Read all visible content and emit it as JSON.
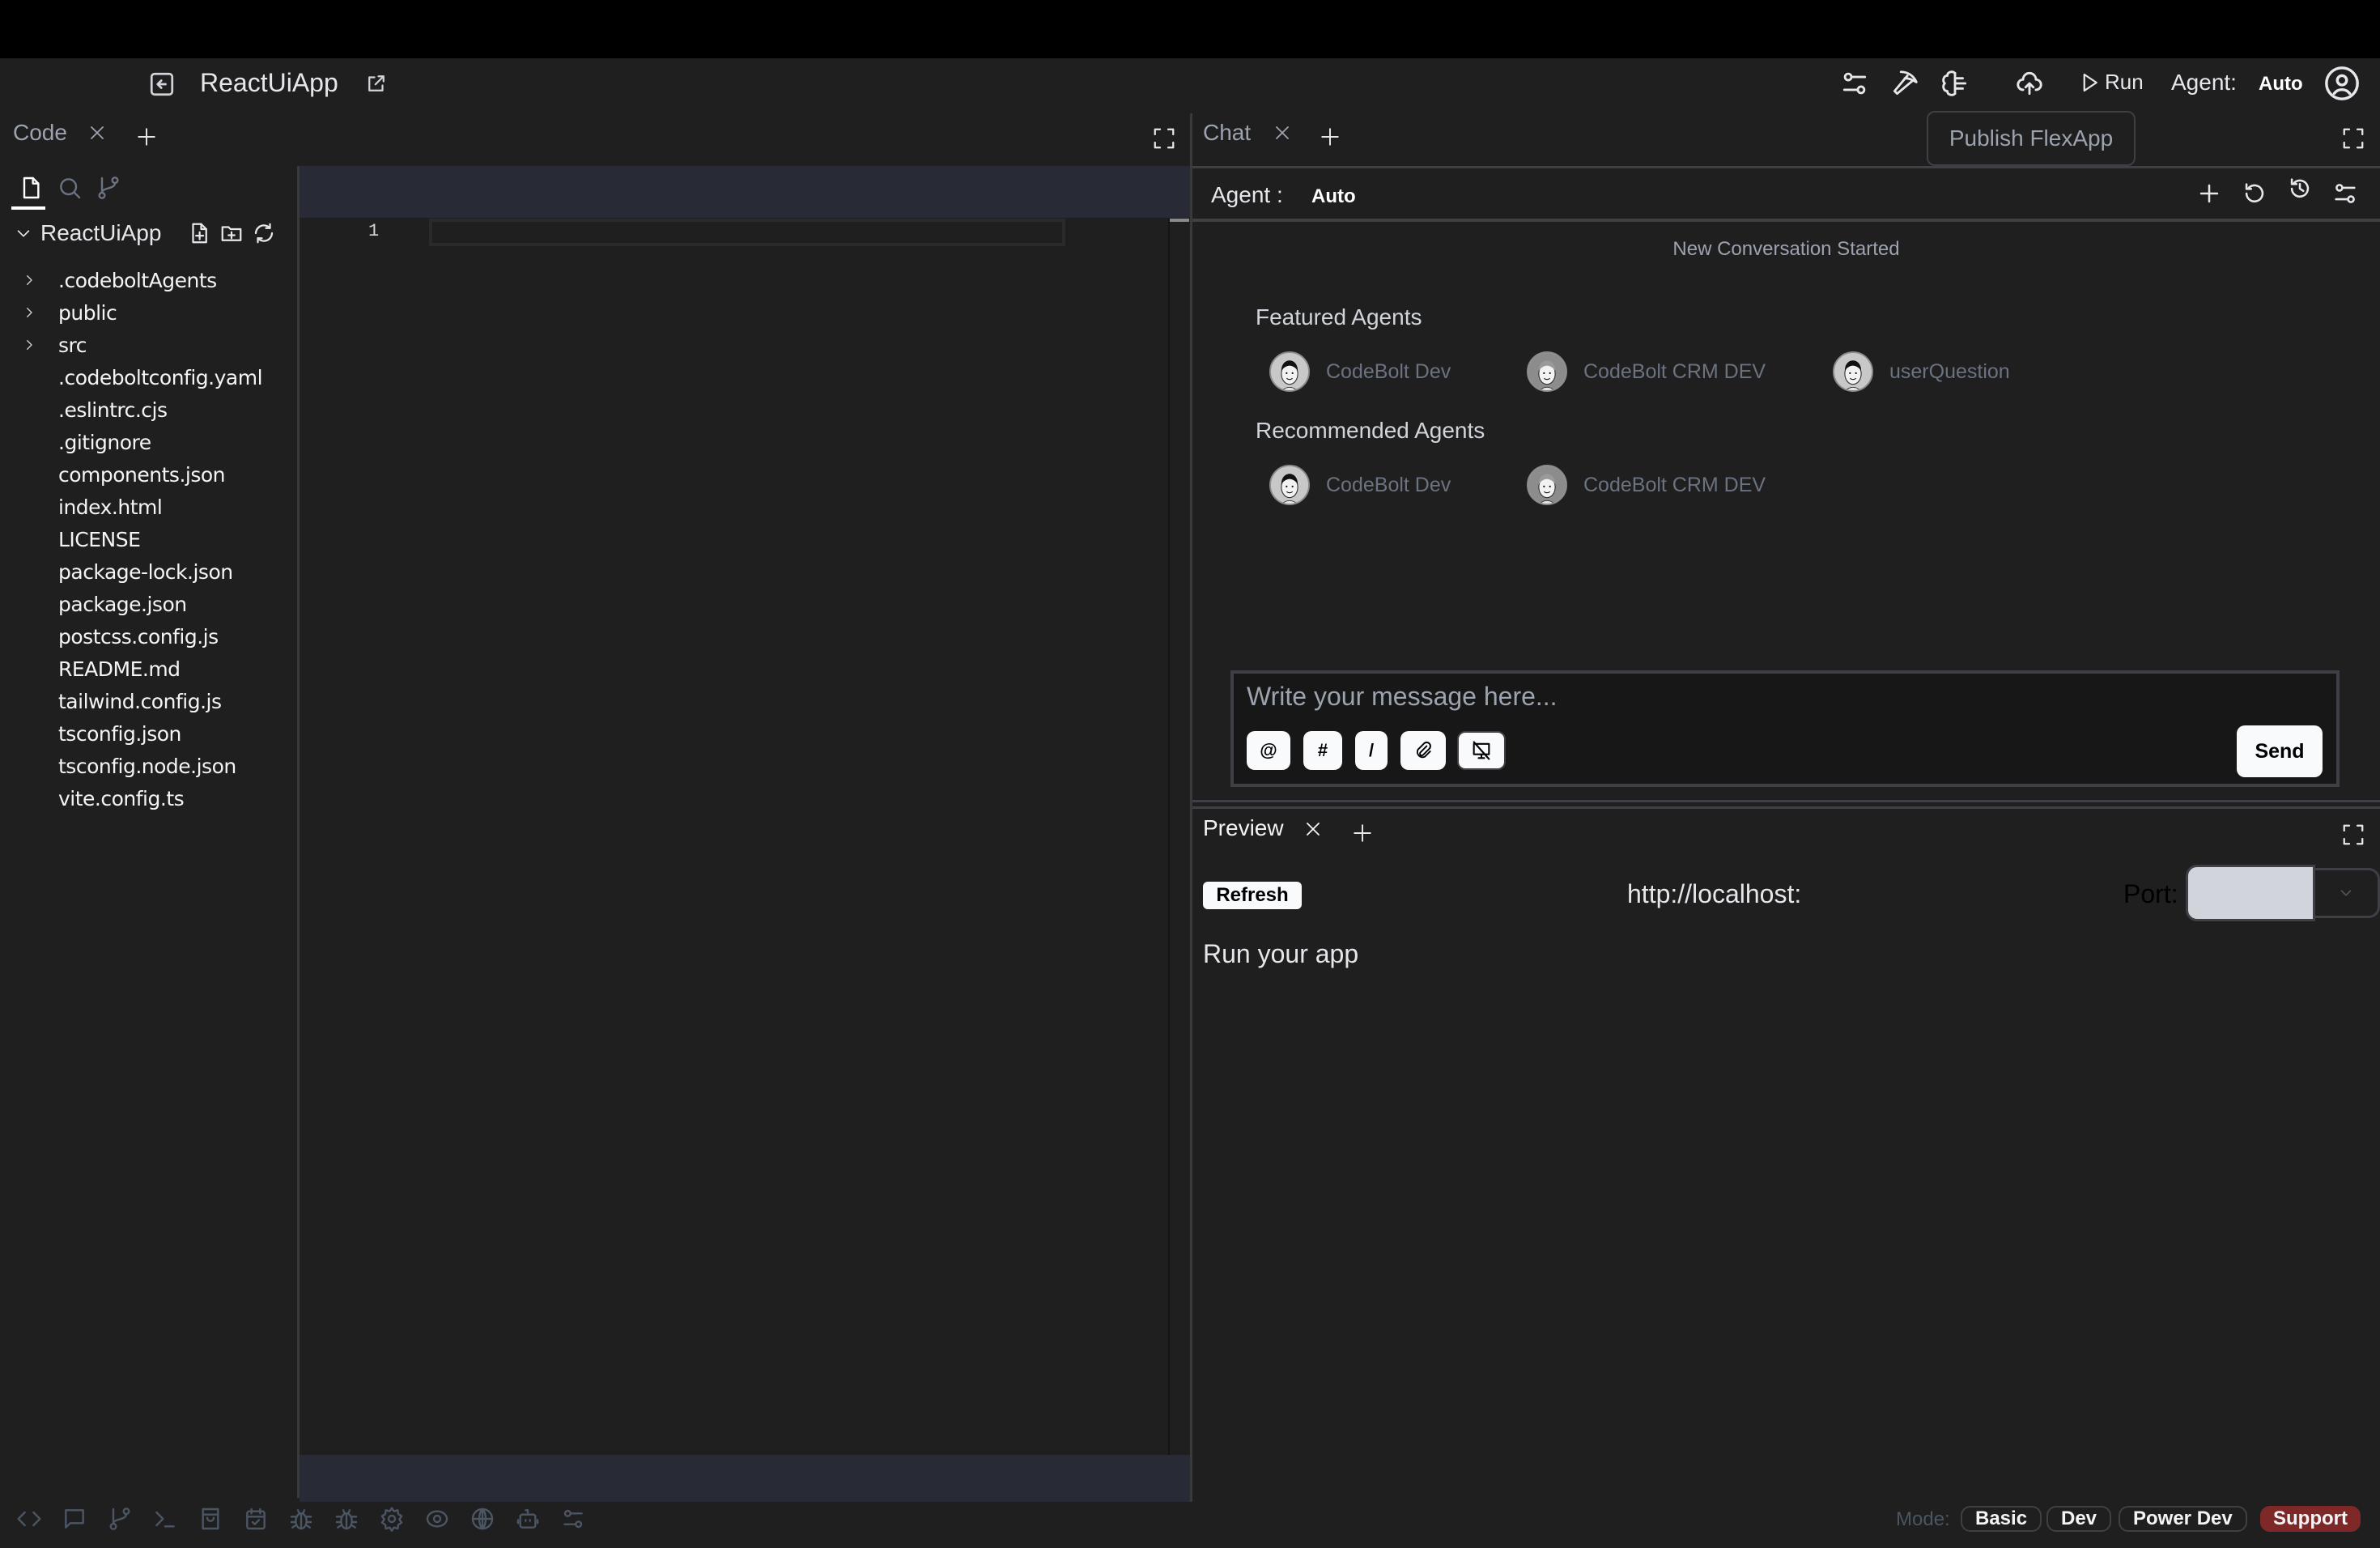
{
  "header": {
    "title": "ReactUiApp",
    "run_label": "Run",
    "agent_label": "Agent:",
    "agent_value": "Auto",
    "icons": [
      "sliders-icon",
      "pickaxe-icon",
      "brain-icon",
      "cloud-upload-icon",
      "play-icon",
      "user-circle-icon"
    ]
  },
  "tooltip": {
    "text": "Publish FlexApp"
  },
  "code_panel": {
    "tab_label": "Code",
    "explorer_tabs": [
      "files",
      "search",
      "source-control"
    ],
    "root_label": "ReactUiApp",
    "tree": [
      {
        "name": ".codeboltAgents",
        "type": "folder"
      },
      {
        "name": "public",
        "type": "folder"
      },
      {
        "name": "src",
        "type": "folder"
      },
      {
        "name": ".codeboltconfig.yaml",
        "type": "file"
      },
      {
        "name": ".eslintrc.cjs",
        "type": "file"
      },
      {
        "name": ".gitignore",
        "type": "file"
      },
      {
        "name": "components.json",
        "type": "file"
      },
      {
        "name": "index.html",
        "type": "file"
      },
      {
        "name": "LICENSE",
        "type": "file"
      },
      {
        "name": "package-lock.json",
        "type": "file"
      },
      {
        "name": "package.json",
        "type": "file"
      },
      {
        "name": "postcss.config.js",
        "type": "file"
      },
      {
        "name": "README.md",
        "type": "file"
      },
      {
        "name": "tailwind.config.js",
        "type": "file"
      },
      {
        "name": "tsconfig.json",
        "type": "file"
      },
      {
        "name": "tsconfig.node.json",
        "type": "file"
      },
      {
        "name": "vite.config.ts",
        "type": "file"
      }
    ],
    "editor": {
      "line_numbers": [
        "1"
      ]
    }
  },
  "chat_panel": {
    "tab_label": "Chat",
    "agent_label": "Agent :",
    "agent_value": "Auto",
    "status": "New Conversation Started",
    "featured_title": "Featured Agents",
    "featured": [
      {
        "name": "CodeBolt Dev"
      },
      {
        "name": "CodeBolt CRM DEV"
      },
      {
        "name": "userQuestion"
      }
    ],
    "recommended_title": "Recommended Agents",
    "recommended": [
      {
        "name": "CodeBolt Dev"
      },
      {
        "name": "CodeBolt CRM DEV"
      }
    ],
    "input": {
      "placeholder": "Write your message here...",
      "value": ""
    },
    "pills": [
      "@",
      "#",
      "/"
    ],
    "send_label": "Send"
  },
  "preview_panel": {
    "tab_label": "Preview",
    "refresh_label": "Refresh",
    "url": "http://localhost:",
    "port_label": "Port:",
    "port_value": "",
    "empty_text": "Run your app"
  },
  "footer": {
    "icons": [
      "code-icon",
      "chat-icon",
      "git-branch-icon",
      "terminal-icon",
      "shopping-bag-icon",
      "calendar-check-icon",
      "bug-icon",
      "bug-alt-icon",
      "gear-icon",
      "eye-icon",
      "globe-icon",
      "robot-icon",
      "sliders-icon"
    ],
    "mode_label": "Mode:",
    "modes": [
      "Basic",
      "Dev",
      "Power Dev"
    ],
    "support_label": "Support",
    "support_color": "#7f2828"
  }
}
